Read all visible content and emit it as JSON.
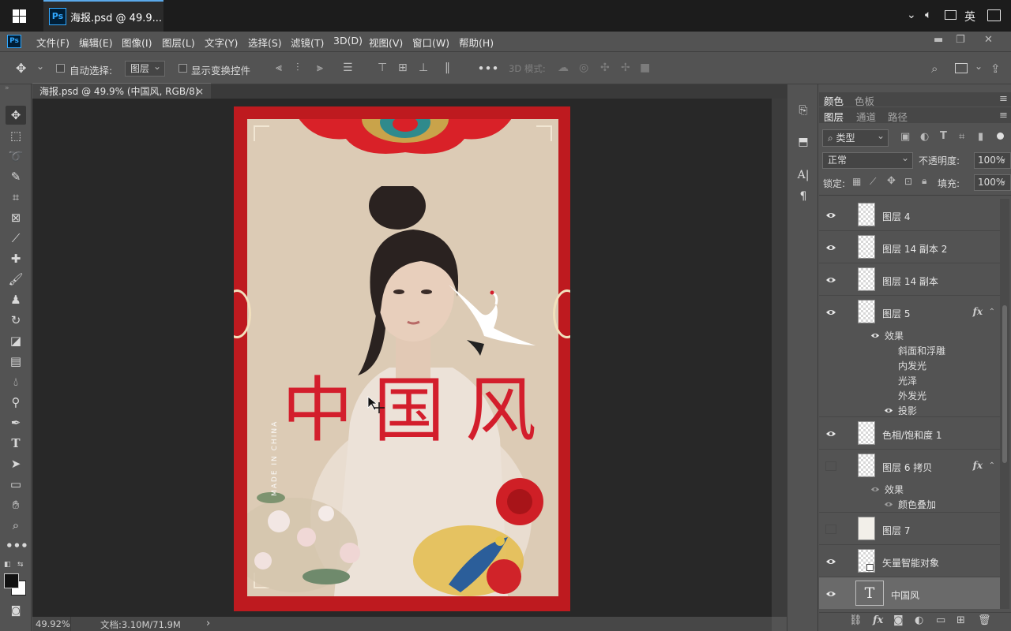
{
  "taskbar": {
    "window_title": "海报.psd @ 49.9...",
    "app_badge": "Ps",
    "ime_label": "英"
  },
  "menubar": {
    "logo": "Ps",
    "items": [
      "文件(F)",
      "编辑(E)",
      "图像(I)",
      "图层(L)",
      "文字(Y)",
      "选择(S)",
      "滤镜(T)",
      "3D(D)",
      "视图(V)",
      "窗口(W)",
      "帮助(H)"
    ]
  },
  "options": {
    "auto_select_label": "自动选择:",
    "auto_select_value": "图层",
    "show_transform_label": "显示变换控件",
    "more": "•••",
    "mode3d_label": "3D 模式:"
  },
  "document": {
    "tab_title": "海报.psd @ 49.9% (中国风, RGB/8)",
    "tab_close": "×"
  },
  "status": {
    "zoom": "49.92%",
    "doc_info": "文档:3.10M/71.9M",
    "arrow": "›"
  },
  "poster": {
    "title": "中国风",
    "made_in": "MADE IN CHINA"
  },
  "panels": {
    "color_tabs": [
      "颜色",
      "色板"
    ],
    "layer_tabs": [
      "图层",
      "通道",
      "路径"
    ],
    "filter_kind": "类型",
    "blend_mode": "正常",
    "opacity_label": "不透明度:",
    "opacity_value": "100%",
    "lock_label": "锁定:",
    "fill_label": "填充:",
    "fill_value": "100%"
  },
  "layers": [
    {
      "name": "图层 4",
      "visible": true,
      "fx": false
    },
    {
      "name": "图层 14 副本 2",
      "visible": true,
      "fx": false
    },
    {
      "name": "图层 14 副本",
      "visible": true,
      "fx": false
    },
    {
      "name": "图层 5",
      "visible": true,
      "fx": true
    },
    {
      "name": "色相/饱和度 1",
      "visible": true,
      "fx": false
    },
    {
      "name": "图层 6 拷贝",
      "visible": false,
      "fx": true
    },
    {
      "name": "图层 7",
      "visible": false,
      "fx": false
    },
    {
      "name": "矢量智能对象",
      "visible": true,
      "fx": false
    },
    {
      "name": "中国风",
      "visible": true,
      "fx": false,
      "selected": true
    }
  ],
  "layer5_effects": {
    "header": "效果",
    "items": [
      "斜面和浮雕",
      "内发光",
      "光泽",
      "外发光",
      "投影"
    ]
  },
  "layer6_effects": {
    "header": "效果",
    "items": [
      "颜色叠加"
    ]
  },
  "fx_symbol": "fx",
  "text_layer_glyph": "T",
  "colors": {
    "poster_red": "#be1a1f",
    "title_red": "#d31e2c",
    "poster_paper": "#dccbb5",
    "ps_blue": "#31a8ff",
    "canvas_bg": "#282828",
    "ui_gray": "#535353"
  }
}
